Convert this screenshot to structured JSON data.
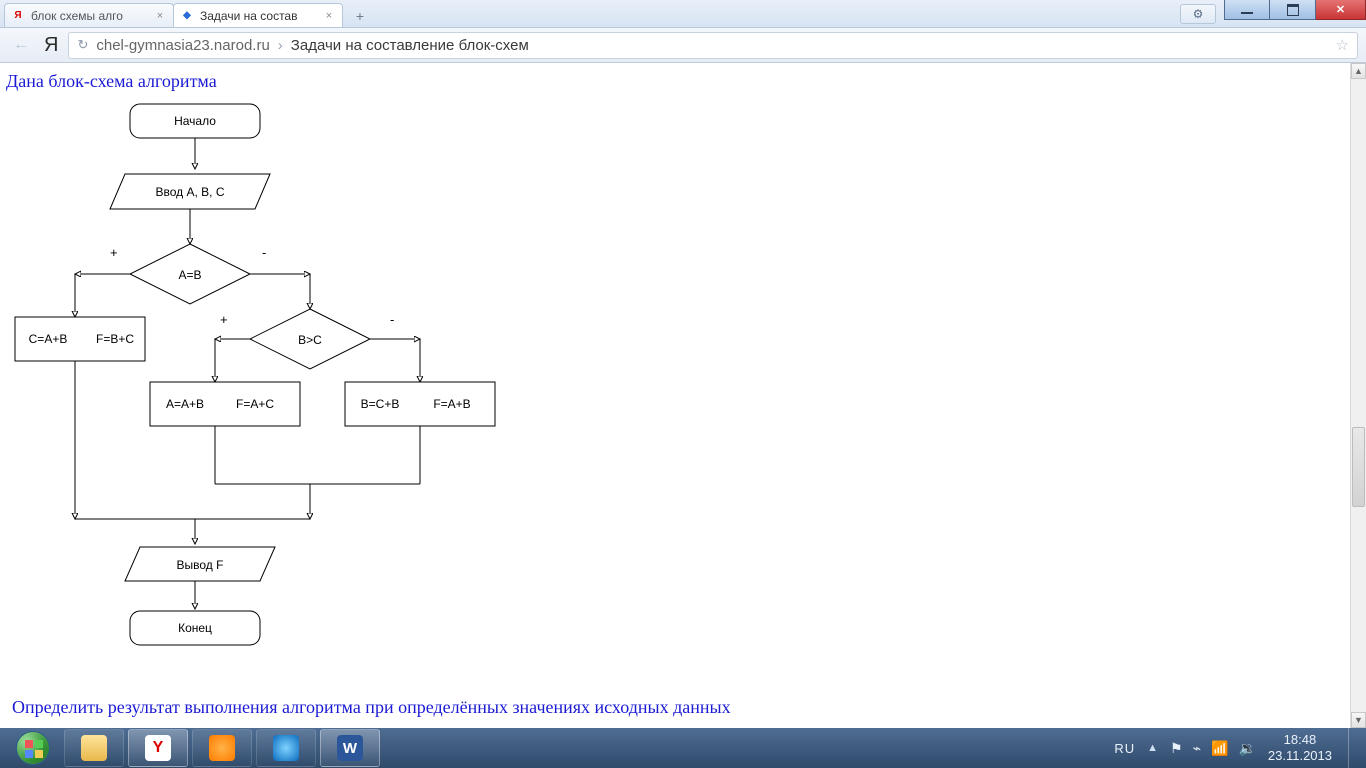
{
  "window": {
    "tabs": [
      {
        "title": "блок схемы алго",
        "favicon": "Я",
        "favclass": "fav-ya",
        "active": false,
        "close": "×"
      },
      {
        "title": "Задачи на состав",
        "favicon": "◆",
        "favclass": "fav-site",
        "active": true,
        "close": "×"
      }
    ],
    "newtab": "+",
    "gear": "⚙",
    "min": "",
    "max": "",
    "close": ""
  },
  "toolbar": {
    "back": "←",
    "ya": "Я",
    "reload": "↻",
    "host": "chel-gymnasia23.narod.ru",
    "sep": "›",
    "title": "Задачи на составление блок-схем",
    "star": "☆"
  },
  "page": {
    "heading_top": "Дана блок-схема алгоритма",
    "heading_bottom": "Определить результат выполнения алгоритма при определённых значениях исходных данных"
  },
  "flow": {
    "start": "Начало",
    "input": "Ввод A, B, C",
    "cond1": "A=B",
    "cond2": "B>C",
    "plus": "+",
    "minus": "-",
    "box_left_a": "C=A+B",
    "box_left_b": "F=B+C",
    "box_mid_a": "A=A+B",
    "box_mid_b": "F=A+C",
    "box_right_a": "B=C+B",
    "box_right_b": "F=A+B",
    "output": "Вывод F",
    "end": "Конец"
  },
  "taskbar": {
    "lang": "RU",
    "up": "▲",
    "tray_icons": [
      "⚑",
      "⌁",
      "📶",
      "🔉"
    ],
    "time": "18:48",
    "date": "23.11.2013"
  }
}
